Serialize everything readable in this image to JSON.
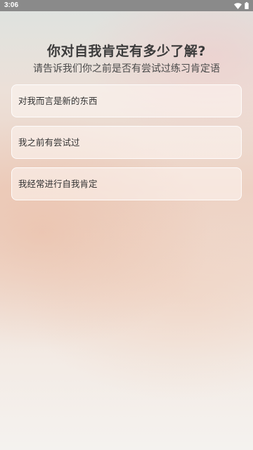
{
  "status_bar": {
    "time": "3:06",
    "icons": [
      "wifi-icon",
      "battery-icon"
    ]
  },
  "question": {
    "title": "你对自我肯定有多少了解?",
    "subtitle": "请告诉我们你之前是否有尝试过练习肯定语"
  },
  "options": [
    {
      "label": "对我而言是新的东西"
    },
    {
      "label": "我之前有尝试过"
    },
    {
      "label": "我经常进行自我肯定"
    }
  ],
  "colors": {
    "status_bar_bg": "#8a8a8a",
    "text_primary": "#3b3b3b",
    "option_border": "#ffffff"
  }
}
